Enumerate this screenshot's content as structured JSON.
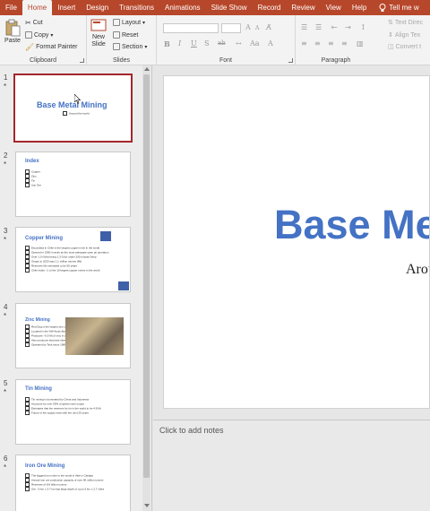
{
  "tabs": [
    "File",
    "Home",
    "Insert",
    "Design",
    "Transitions",
    "Animations",
    "Slide Show",
    "Record",
    "Review",
    "View",
    "Help",
    "Tell me w"
  ],
  "ribbon": {
    "clipboard": {
      "label": "Clipboard",
      "paste": "Paste",
      "cut": "Cut",
      "copy": "Copy",
      "format_painter": "Format Painter"
    },
    "slides": {
      "label": "Slides",
      "new_slide_1": "New",
      "new_slide_2": "Slide",
      "layout": "Layout",
      "reset": "Reset",
      "section": "Section"
    },
    "font": {
      "label": "Font",
      "bold": "B",
      "italic": "I",
      "underline": "U",
      "strike": "S",
      "shadow": "ab",
      "grow": "A",
      "shrink": "A"
    },
    "paragraph": {
      "label": "Paragraph",
      "text_direction": "Text Direc",
      "align_text": "Align Tex",
      "convert": "Convert t"
    }
  },
  "slides": [
    {
      "num": "1",
      "star": "*",
      "title": "Base Metal Mining",
      "subtitle": "Around the world"
    },
    {
      "num": "2",
      "star": "*",
      "title": "Index",
      "items": [
        "Copper",
        "Zinc",
        "Tin",
        "Iron Ore"
      ]
    },
    {
      "num": "3",
      "star": "*",
      "title": "Copper Mining",
      "items": [
        "Escondida in Chile is the largest copper mine in the world",
        "Opened in 1990 it ranks as the most adequate open pit operation",
        "Over 1.0 Gt/ha being 1.3 Gt/yr under 200 m/year Deep",
        "Output in 2023 was 1.1 million tonnes (Mt)",
        "Reserves life estimated to be 50 years",
        "Chile holds ~1 of the 10 largest copper mines in the world"
      ]
    },
    {
      "num": "4",
      "star": "*",
      "title": "Zinc Mining",
      "items": [
        "Red Dog is the largest zinc operation in the world",
        "Located in the NW Arctic Borough of Alaska",
        "Produces ~0.5 Mt of zinc in concentrate",
        "Also produces lead and silver",
        "Operated by Teck since 1989"
      ]
    },
    {
      "num": "5",
      "star": "*",
      "title": "Tin Mining",
      "items": [
        "Tin mining is dominated by China and Indonesia",
        "Accounts for over 55% of global mine output",
        "Estimates that the reserves for tin in the world to be 4.8 Mt",
        "Future of the supply rests with the next 25 years"
      ]
    },
    {
      "num": "6",
      "star": "*",
      "title": "Iron Ore Mining",
      "items": [
        "The biggest iron mine in the world is Vale in Carajas",
        "Annual iron ore production capacity of over 90 million tonnes",
        "Reserves of 8.8 billion tonnes",
        "Ore - 5 km x 3.7 km has large depth of up to 5 km x 2.7 miles"
      ]
    }
  ],
  "main_slide": {
    "title": "Base Me",
    "subtitle": "Arou"
  },
  "notes_placeholder": "Click to add notes",
  "colors": {
    "accent": "#b7472a",
    "title_blue": "#4472c4",
    "selected_border": "#a4262c"
  }
}
